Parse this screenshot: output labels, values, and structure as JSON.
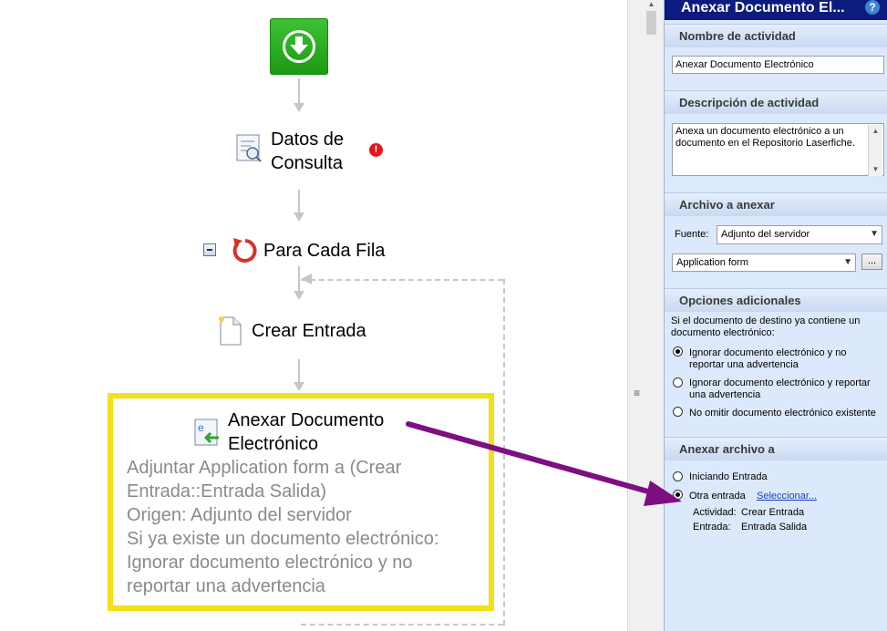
{
  "canvas": {
    "node_query": {
      "line1": "Datos de",
      "line2": "Consulta",
      "error_mark": "!"
    },
    "node_foreach": {
      "label": "Para Cada Fila"
    },
    "node_create": {
      "label": "Crear Entrada"
    },
    "node_attach": {
      "line1": "Anexar Documento",
      "line2": "Electrónico",
      "details": [
        "Adjuntar Application form a (Crear",
        "Entrada::Entrada Salida)",
        "Origen: Adjunto del servidor",
        "Si ya existe un documento electrónico:",
        "Ignorar documento electrónico y no",
        "reportar una advertencia"
      ]
    },
    "colors": {
      "highlight": "#f2e01a",
      "pointer_arrow": "#7d0f83",
      "start_button": "#26a61b"
    }
  },
  "panel": {
    "title": "Anexar Documento El...",
    "help": "?",
    "sec_name": {
      "header": "Nombre de actividad",
      "value": "Anexar Documento Electrónico"
    },
    "sec_desc": {
      "header": "Descripción de actividad",
      "value": "Anexa un documento electrónico a un documento en el Repositorio Laserfiche."
    },
    "sec_file": {
      "header": "Archivo a anexar",
      "source_label": "Fuente:",
      "source_value": "Adjunto del servidor",
      "file_value": "Application form",
      "browse": "..."
    },
    "sec_opts": {
      "header": "Opciones adicionales",
      "intro": "Si el documento de destino ya contiene un documento electrónico:",
      "options": [
        "Ignorar documento electrónico y no reportar una advertencia",
        "Ignorar documento electrónico y reportar una advertencia",
        "No omitir documento electrónico existente"
      ],
      "selected_index": 0
    },
    "sec_target": {
      "header": "Anexar archivo a",
      "opt_start": "Iniciando Entrada",
      "opt_other": "Otra entrada",
      "select_link": "Seleccionar...",
      "activity_label": "Actividad:",
      "activity_value": "Crear Entrada",
      "entry_label": "Entrada:",
      "entry_value": "Entrada Salida"
    }
  }
}
